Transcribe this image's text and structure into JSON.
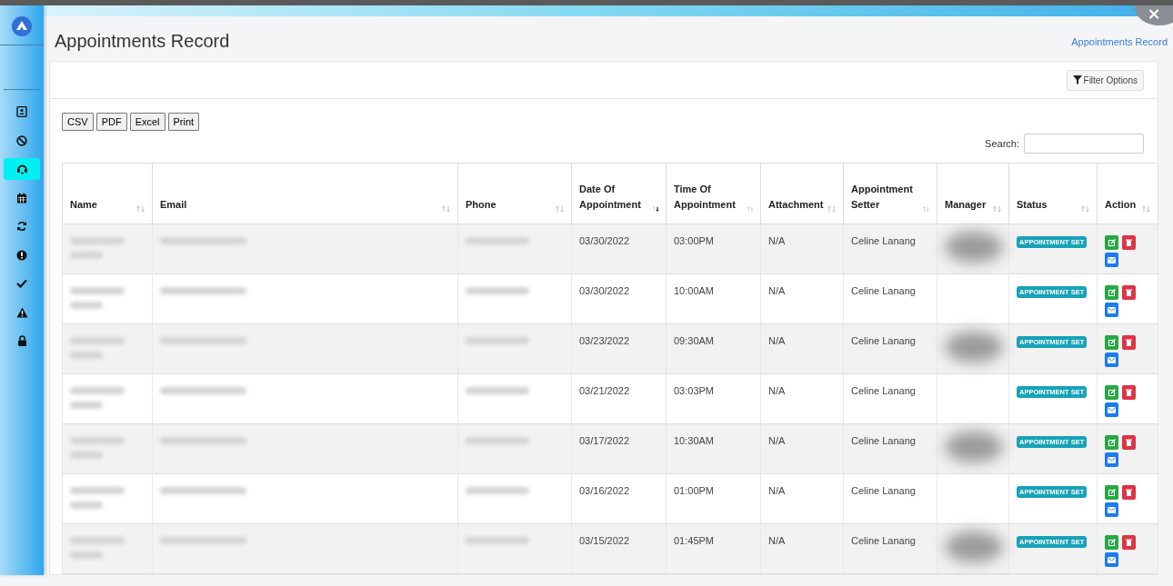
{
  "sidebar": {
    "items": [
      {
        "kind": "contact",
        "selected": false
      },
      {
        "kind": "ban",
        "selected": false
      },
      {
        "kind": "headset",
        "selected": true
      },
      {
        "kind": "calendar",
        "selected": false
      },
      {
        "kind": "sync",
        "selected": false
      },
      {
        "kind": "alert",
        "selected": false
      },
      {
        "kind": "check",
        "selected": false
      },
      {
        "kind": "warning",
        "selected": false
      },
      {
        "kind": "lock",
        "selected": false
      }
    ]
  },
  "close_button": "×",
  "page_title": "Appointments Record",
  "breadcrumb": "Appointments Record",
  "filter_button": "Filter Options",
  "export_buttons": [
    "CSV",
    "PDF",
    "Excel",
    "Print"
  ],
  "search": {
    "label": "Search:"
  },
  "table": {
    "columns": [
      {
        "label": "Name",
        "sorted": false
      },
      {
        "label": "Email",
        "sorted": false
      },
      {
        "label": "Phone",
        "sorted": false
      },
      {
        "label": "Date Of Appointment",
        "sorted": true
      },
      {
        "label": "Time Of Appointment",
        "sorted": false
      },
      {
        "label": "Attachment",
        "sorted": false
      },
      {
        "label": "Appointment Setter",
        "sorted": false
      },
      {
        "label": "Manager",
        "sorted": false
      },
      {
        "label": "Status",
        "sorted": false
      },
      {
        "label": "Action",
        "sorted": false
      }
    ],
    "rows": [
      {
        "date": "03/30/2022",
        "time": "03:00PM",
        "attachment": "N/A",
        "setter": "Celine Lanang",
        "manager_blurred": true,
        "status": "APPOINTMENT SET"
      },
      {
        "date": "03/30/2022",
        "time": "10:00AM",
        "attachment": "N/A",
        "setter": "Celine Lanang",
        "manager_blurred": false,
        "status": "APPOINTMENT SET"
      },
      {
        "date": "03/23/2022",
        "time": "09:30AM",
        "attachment": "N/A",
        "setter": "Celine Lanang",
        "manager_blurred": true,
        "status": "APPOINTMENT SET"
      },
      {
        "date": "03/21/2022",
        "time": "03:03PM",
        "attachment": "N/A",
        "setter": "Celine Lanang",
        "manager_blurred": false,
        "status": "APPOINTMENT SET"
      },
      {
        "date": "03/17/2022",
        "time": "10:30AM",
        "attachment": "N/A",
        "setter": "Celine Lanang",
        "manager_blurred": true,
        "status": "APPOINTMENT SET"
      },
      {
        "date": "03/16/2022",
        "time": "01:00PM",
        "attachment": "N/A",
        "setter": "Celine Lanang",
        "manager_blurred": false,
        "status": "APPOINTMENT SET"
      },
      {
        "date": "03/15/2022",
        "time": "01:45PM",
        "attachment": "N/A",
        "setter": "Celine Lanang",
        "manager_blurred": true,
        "status": "APPOINTMENT SET"
      }
    ]
  }
}
